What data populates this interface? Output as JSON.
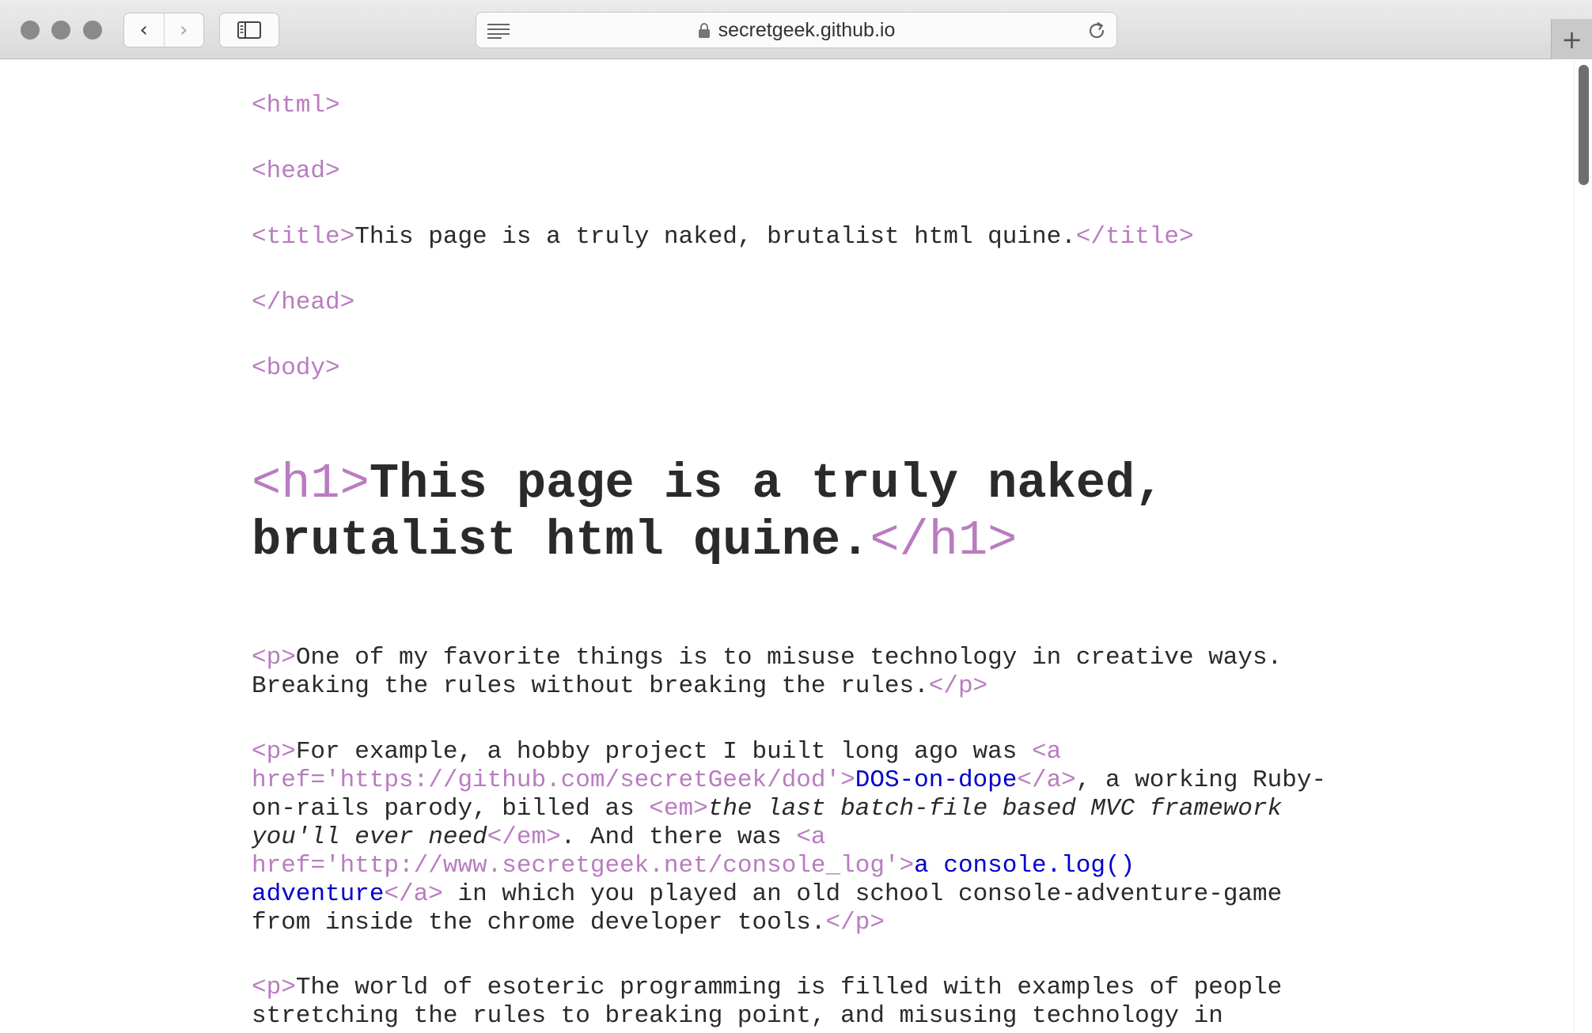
{
  "browser": {
    "url": "secretgeek.github.io",
    "back_glyph": "‹",
    "forward_glyph": "›",
    "new_tab_glyph": "+"
  },
  "page": {
    "tags": {
      "html_open": "<html>",
      "head_open": "<head>",
      "title_open": "<title>",
      "title_close": "</title>",
      "head_close": "</head>",
      "body_open": "<body>",
      "h1_open": "<h1>",
      "h1_close": "</h1>",
      "p_open": "<p>",
      "p_close": "</p>",
      "a_open_1": "<a\nhref='https://github.com/secretGeek/dod'>",
      "a_close": "</a>",
      "em_open": "<em>",
      "em_close": "</em>",
      "a_open_2": "<a\nhref='http://www.secretgeek.net/console_log'>"
    },
    "title_text": "This page is a truly naked, brutalist html quine.",
    "h1_text": "This page is a truly naked, brutalist html quine.",
    "p1_text": "One of my favorite things is to misuse technology in creative ways. Breaking the rules without breaking the rules.",
    "p2": {
      "before_link1": "For example, a hobby project I built long ago was ",
      "link1_text": "DOS-on-dope",
      "after_link1": ", a working Ruby-on-rails parody, billed as ",
      "em_text": "the last batch-file based MVC framework you'll ever need",
      "after_em": ". And there was ",
      "link2_text": "a console.log() adventure",
      "after_link2": " in which you played an old school console-adventure-game from inside the chrome developer tools."
    },
    "p3_text": "The world of esoteric programming is filled with examples of people stretching the rules to breaking point, and misusing technology in"
  },
  "colors": {
    "tag": "#b97cc0",
    "text": "#2a2a2a",
    "link": "#0000cc"
  }
}
